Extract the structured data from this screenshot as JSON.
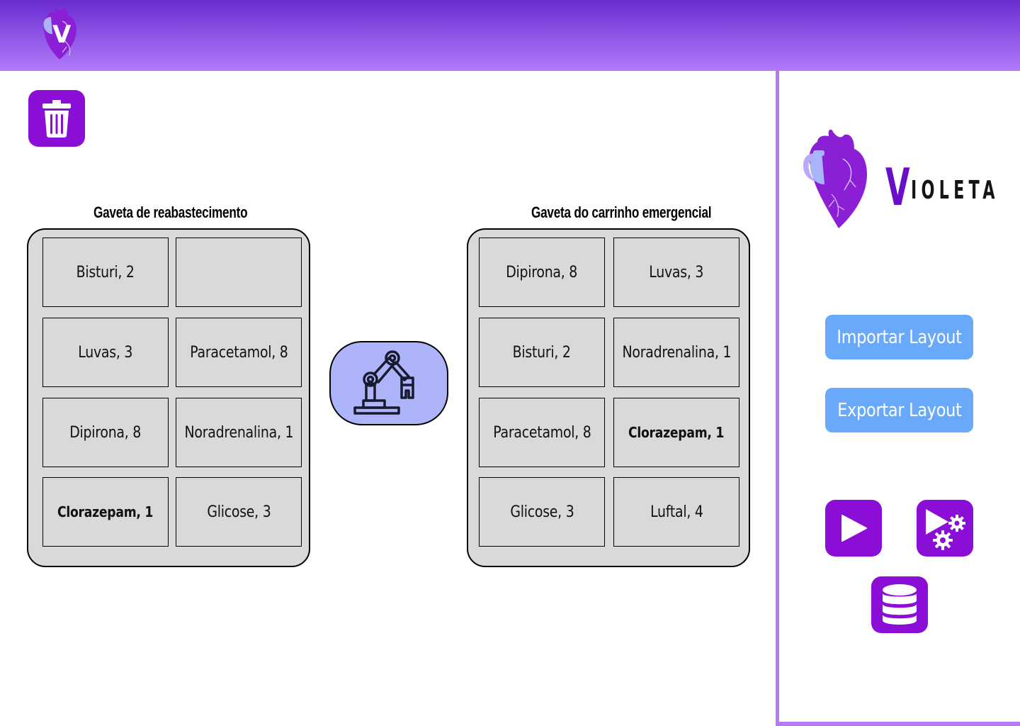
{
  "header": {
    "logo_letter": "V"
  },
  "toolbar": {
    "trash_icon": "trash-icon"
  },
  "drawers": {
    "refill": {
      "title": "Gaveta de reabastecimento",
      "cells": [
        "Bisturi, 2",
        "",
        "Luvas, 3",
        "Paracetamol, 8",
        "Dipirona, 8",
        "Noradrenalina, 1",
        "Clorazepam, 1",
        "Glicose, 3"
      ]
    },
    "emergency": {
      "title": "Gaveta do carrinho emergencial",
      "cells": [
        "Dipirona, 8",
        "Luvas, 3",
        "Bisturi, 2",
        "Noradrenalina, 1",
        "Paracetamol, 8",
        "Clorazepam, 1",
        "Glicose, 3",
        "Luftal, 4"
      ]
    }
  },
  "robot": {
    "icon": "robot-arm-icon"
  },
  "sidebar": {
    "brand_first": "V",
    "brand_rest": "IOLETA",
    "import_label": "Importar Layout",
    "export_label": "Exportar Layout",
    "icons": [
      "play-icon",
      "play-settings-icon",
      "database-icon"
    ]
  },
  "colors": {
    "header_top": "#6a2cd0",
    "header_bottom": "#b27bfa",
    "accent_purple": "#8a0ed6",
    "button_blue": "#68a9fb",
    "robot_bg": "#aeb4f9",
    "cell_bg": "#d9d9d9",
    "sidebar_border": "#b57bf6"
  }
}
